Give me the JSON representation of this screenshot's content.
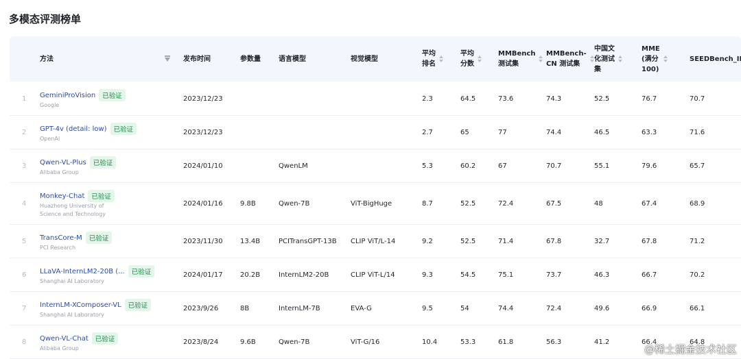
{
  "page": {
    "title": "多模态评测榜单"
  },
  "columns": {
    "method": "方法",
    "release": "发布时间",
    "params": "参数量",
    "lang_model": "语言模型",
    "vis_model": "视觉模型",
    "avg_rank_1": "平均",
    "avg_rank_2": "排名",
    "avg_score_1": "平均",
    "avg_score_2": "分数",
    "mmbench_1": "MMBench",
    "mmbench_2": "测试集",
    "mmbench_cn_1": "MMBench-",
    "mmbench_cn_2": "CN 测试集",
    "chinese_1": "中国文",
    "chinese_2": "化测试",
    "chinese_3": "集",
    "mme_1": "MME",
    "mme_2": "(满分",
    "mme_3": "100)",
    "seed": "SEEDBench_IM"
  },
  "verified_label": "已验证",
  "rows": [
    {
      "idx": "1",
      "name": "GeminiProVision",
      "verified": true,
      "org": [
        "Google"
      ],
      "release": "2023/12/23",
      "params": "",
      "lang": "",
      "vis": "",
      "rank": "2.3",
      "score": "64.5",
      "mmb": "73.6",
      "mmbcn": "74.3",
      "cn": "52.5",
      "mme": "76.7",
      "seed": "70.7"
    },
    {
      "idx": "2",
      "name": "GPT-4v (detail: low)",
      "verified": true,
      "org": [
        "OpenAI"
      ],
      "release": "2023/12/23",
      "params": "",
      "lang": "",
      "vis": "",
      "rank": "2.7",
      "score": "65",
      "mmb": "77",
      "mmbcn": "74.4",
      "cn": "46.5",
      "mme": "63.3",
      "seed": "71.6"
    },
    {
      "idx": "3",
      "name": "Qwen-VL-Plus",
      "verified": true,
      "org": [
        "Alibaba Group"
      ],
      "release": "2024/01/10",
      "params": "",
      "lang": "QwenLM",
      "vis": "",
      "rank": "5.3",
      "score": "60.2",
      "mmb": "67",
      "mmbcn": "70.7",
      "cn": "55.1",
      "mme": "79.6",
      "seed": "65.7"
    },
    {
      "idx": "4",
      "name": "Monkey-Chat",
      "verified": true,
      "org": [
        "Huazhong University of",
        "Science and Technology"
      ],
      "release": "2024/01/16",
      "params": "9.8B",
      "lang": "Qwen-7B",
      "vis": "ViT-BigHuge",
      "rank": "8.7",
      "score": "52.5",
      "mmb": "72.4",
      "mmbcn": "67.5",
      "cn": "48",
      "mme": "67.4",
      "seed": "68.9"
    },
    {
      "idx": "5",
      "name": "TransCore-M",
      "verified": true,
      "org": [
        "PCI Research"
      ],
      "release": "2023/11/30",
      "params": "13.4B",
      "lang": "PCITransGPT-13B",
      "vis": "CLIP ViT/L-14",
      "rank": "9.2",
      "score": "52.5",
      "mmb": "71.4",
      "mmbcn": "67.8",
      "cn": "32.7",
      "mme": "67.8",
      "seed": "71.2"
    },
    {
      "idx": "6",
      "name": "LLaVA-InternLM2-20B (...",
      "verified": true,
      "org": [
        "Shanghai AI Laboratory"
      ],
      "release": "2024/01/17",
      "params": "20.2B",
      "lang": "InternLM2-20B",
      "vis": "CLIP ViT-L/14",
      "rank": "9.3",
      "score": "54.5",
      "mmb": "75.1",
      "mmbcn": "73.7",
      "cn": "46.3",
      "mme": "66.7",
      "seed": "70.2"
    },
    {
      "idx": "7",
      "name": "InternLM-XComposer-VL",
      "verified": true,
      "org": [
        "Shanghai AI Laboratory"
      ],
      "release": "2023/9/26",
      "params": "8B",
      "lang": "InternLM-7B",
      "vis": "EVA-G",
      "rank": "9.5",
      "score": "54",
      "mmb": "74.4",
      "mmbcn": "72.4",
      "cn": "49.6",
      "mme": "66.9",
      "seed": "66.1"
    },
    {
      "idx": "8",
      "name": "Qwen-VL-Chat",
      "verified": true,
      "org": [
        "Alibaba Group"
      ],
      "release": "2023/8/24",
      "params": "9.6B",
      "lang": "Qwen-7B",
      "vis": "ViT-G/16",
      "rank": "10.4",
      "score": "53.3",
      "mmb": "61.8",
      "mmbcn": "56.3",
      "cn": "41.2",
      "mme": "66.4",
      "seed": "64.8"
    }
  ],
  "watermark": "@稀土掘金技术社区"
}
